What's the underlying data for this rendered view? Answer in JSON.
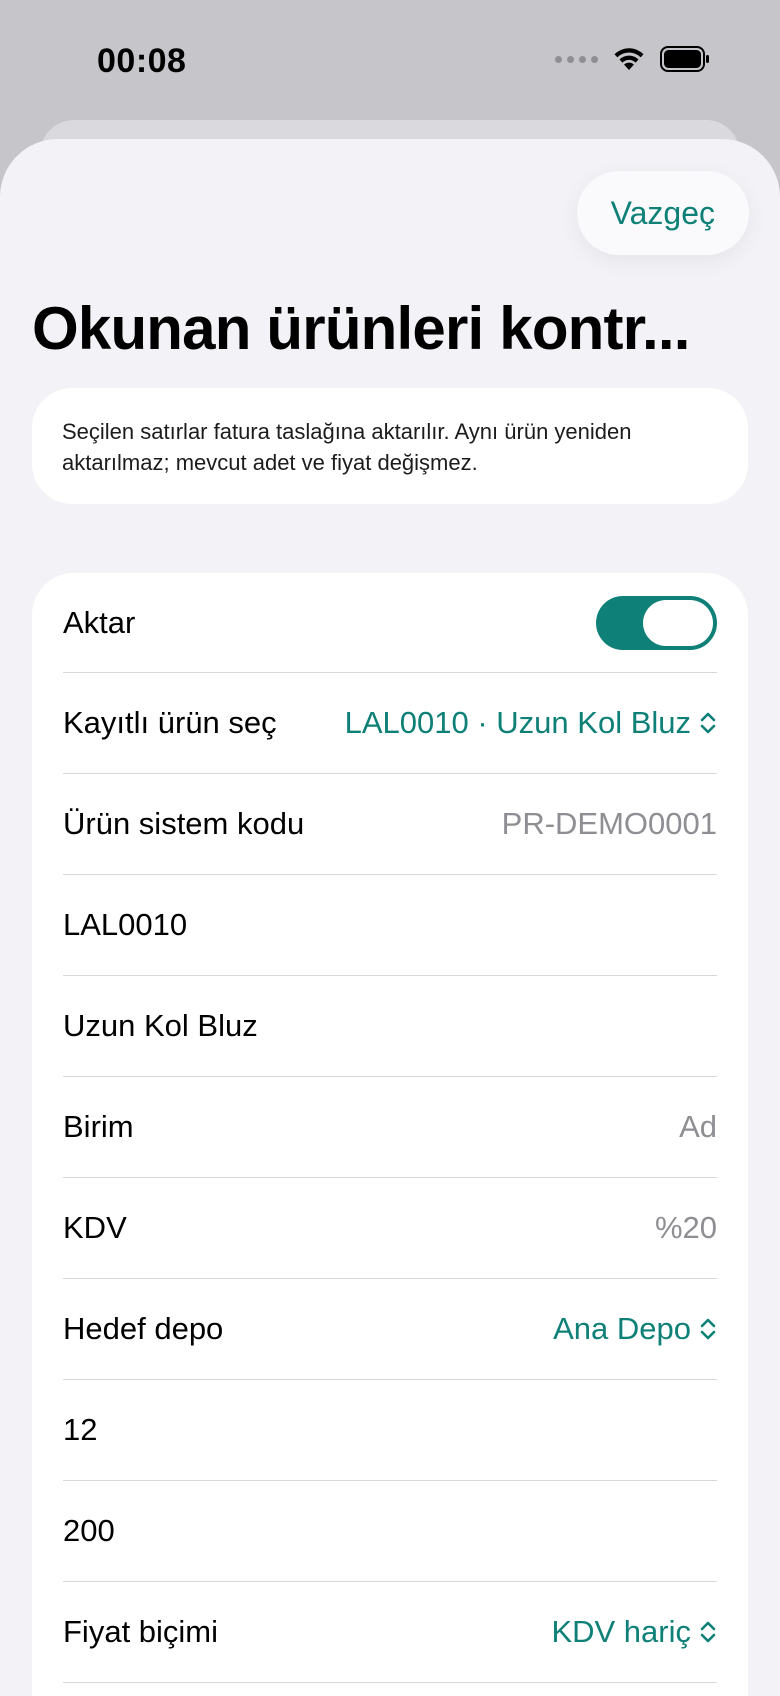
{
  "status_bar": {
    "time": "00:08"
  },
  "header": {
    "cancel_label": "Vazgeç",
    "title": "Okunan ürünleri kontr..."
  },
  "info": {
    "text": "Seçilen satırlar fatura taslağına aktarılır. Aynı ürün yeniden aktarılmaz; mevcut adet ve fiyat değişmez."
  },
  "form": {
    "transfer": {
      "label": "Aktar",
      "on": true
    },
    "registered_product": {
      "label": "Kayıtlı ürün seç",
      "value": "LAL0010 · Uzun Kol Bluz"
    },
    "system_code": {
      "label": "Ürün sistem kodu",
      "value": "PR-DEMO0001"
    },
    "product_code": {
      "value": "LAL0010"
    },
    "product_name": {
      "value": "Uzun Kol Bluz"
    },
    "unit": {
      "label": "Birim",
      "value": "Ad"
    },
    "vat": {
      "label": "KDV",
      "value": "%20"
    },
    "target_warehouse": {
      "label": "Hedef depo",
      "value": "Ana Depo"
    },
    "quantity": {
      "value": "12"
    },
    "price": {
      "value": "200"
    },
    "price_format": {
      "label": "Fiyat biçimi",
      "value": "KDV hariç"
    }
  },
  "colors": {
    "accent": "#0e8077",
    "background": "#f2f2f7",
    "card": "#ffffff"
  }
}
